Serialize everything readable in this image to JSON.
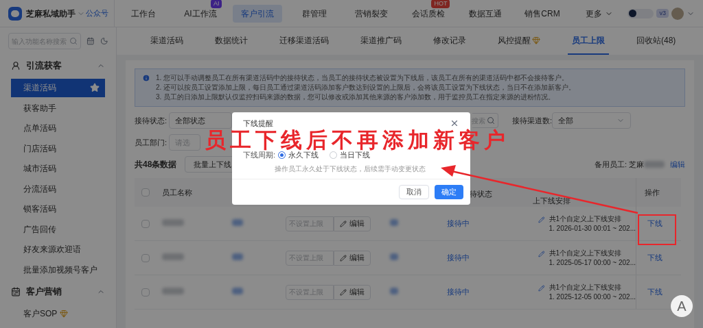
{
  "header": {
    "brand": "芝麻私域助手",
    "account_link": "公众号",
    "nav": [
      {
        "label": "工作台",
        "selected": false,
        "dropdown": false
      },
      {
        "label": "AI工作流",
        "selected": false,
        "dropdown": false,
        "badge": {
          "text": "AI",
          "kind": "ai"
        }
      },
      {
        "label": "客户引流",
        "selected": true,
        "dropdown": false
      },
      {
        "label": "群管理",
        "selected": false,
        "dropdown": false
      },
      {
        "label": "营销裂变",
        "selected": false,
        "dropdown": false
      },
      {
        "label": "会话质检",
        "selected": false,
        "dropdown": false,
        "badge": {
          "text": "HOT",
          "kind": "hot"
        }
      },
      {
        "label": "数据互通",
        "selected": false,
        "dropdown": false
      },
      {
        "label": "销售CRM",
        "selected": false,
        "dropdown": false
      },
      {
        "label": "更多",
        "selected": false,
        "dropdown": true
      }
    ],
    "version": "v3"
  },
  "sidebar": {
    "search_placeholder": "输入功能名称搜索",
    "groups": [
      {
        "title": "引流获客",
        "expanded": true,
        "items": [
          {
            "label": "渠道活码",
            "selected": true,
            "premium": false
          },
          {
            "label": "获客助手",
            "selected": false,
            "premium": false
          },
          {
            "label": "点单活码",
            "selected": false,
            "premium": false
          },
          {
            "label": "门店活码",
            "selected": false,
            "premium": false
          },
          {
            "label": "城市活码",
            "selected": false,
            "premium": false
          },
          {
            "label": "分流活码",
            "selected": false,
            "premium": false
          },
          {
            "label": "锁客活码",
            "selected": false,
            "premium": false
          },
          {
            "label": "广告回传",
            "selected": false,
            "premium": false
          },
          {
            "label": "好友来源欢迎语",
            "selected": false,
            "premium": false
          },
          {
            "label": "批量添加视频号客户",
            "selected": false,
            "premium": false
          }
        ]
      },
      {
        "title": "客户营销",
        "expanded": true,
        "items": [
          {
            "label": "客户SOP",
            "selected": false,
            "premium": true
          }
        ]
      }
    ]
  },
  "subtabs": [
    {
      "label": "渠道活码",
      "selected": false,
      "premium": false
    },
    {
      "label": "数据统计",
      "selected": false,
      "premium": false
    },
    {
      "label": "迁移渠道活码",
      "selected": false,
      "premium": false
    },
    {
      "label": "渠道推广码",
      "selected": false,
      "premium": false
    },
    {
      "label": "修改记录",
      "selected": false,
      "premium": false
    },
    {
      "label": "风控提醒",
      "selected": false,
      "premium": true
    },
    {
      "label": "员工上限",
      "selected": true,
      "premium": false
    },
    {
      "label": "回收站(48)",
      "selected": false,
      "premium": false
    }
  ],
  "notice": [
    "1. 您可以手动调整员工在所有渠道活码中的接待状态，当员工的接待状态被设置为下线后，该员工在所有的渠道活码中都不会接待客户。",
    "2. 还可以按员工设置添加上限，每日员工通过渠道活码添加客户数达到设置的上限后，会将该员工设置为下线状态，当日不在添加新客户。",
    "3. 员工的日添加上限默认仅监控扫码来源的数据，您可以修改或添加其他来源的客户添加数，用于监控员工在指定来源的进粉情况。"
  ],
  "filters": {
    "status_label": "接待状态:",
    "status_value": "全部状态",
    "search_placeholder": "搜索",
    "channels_label": "接待渠道数:",
    "channels_value": "全部",
    "dept_label": "员工部门:",
    "dept_placeholder": "请选"
  },
  "toolbar": {
    "total": "共48条数据",
    "batch_button": "批量上下线",
    "backup_label": "备用员工: 芝麻",
    "backup_edit": "编辑"
  },
  "table": {
    "all_checked": false,
    "columns": {
      "name": "员工名称",
      "status": "待状态",
      "schedule": "上下线安排",
      "action": "操作"
    },
    "rows": [
      {
        "checked": false,
        "limit_placeholder": "不设置上限",
        "edit": "编辑",
        "status": "接待中",
        "schedule_title": "共1个自定义上下线安排",
        "schedule_detail": "1. 2026-01-30 00:01 ~ 202...",
        "action": "下线"
      },
      {
        "checked": false,
        "limit_placeholder": "不设置上限",
        "edit": "编辑",
        "status": "接待中",
        "schedule_title": "共1个自定义上下线安排",
        "schedule_detail": "1. 2025-05-17 00:00 ~ 202...",
        "action": "下线"
      },
      {
        "checked": false,
        "limit_placeholder": "不设置上限",
        "edit": "编辑",
        "status": "接待中",
        "schedule_title": "共1个自定义上下线安排",
        "schedule_detail": "1. 2025-12-05 00:00 ~ 202...",
        "action": "下线"
      }
    ]
  },
  "modal": {
    "title": "下线提醒",
    "field_label": "下线周期:",
    "options": [
      {
        "label": "永久下线",
        "selected": true
      },
      {
        "label": "当日下线",
        "selected": false
      }
    ],
    "hint": "操作员工永久处于下线状态，后续需手动变更状态",
    "buttons": [
      {
        "label": "取消",
        "kind": "secondary"
      },
      {
        "label": "确定",
        "kind": "primary"
      }
    ]
  },
  "annotation": {
    "text": "员工下线后不再添加新客户"
  },
  "float_button": "A"
}
